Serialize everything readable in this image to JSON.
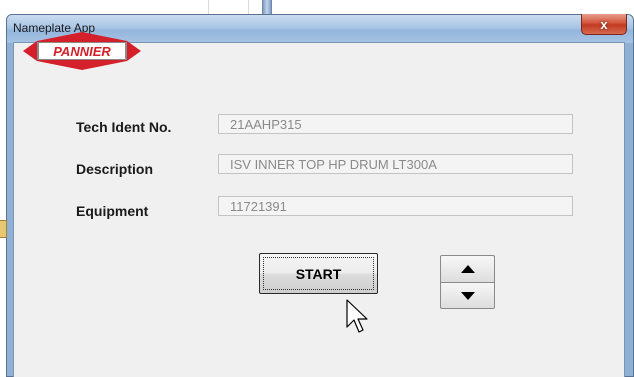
{
  "window": {
    "title": "Nameplate App",
    "close_label": "x"
  },
  "logo": {
    "text": "PANNIER",
    "colors": {
      "red": "#d4202a",
      "white": "#ffffff",
      "gray": "#8a8a8a"
    }
  },
  "form": {
    "fields": [
      {
        "label": "Tech Ident No.",
        "value": "21AAHP315"
      },
      {
        "label": "Description",
        "value": "ISV INNER TOP HP DRUM LT300A"
      },
      {
        "label": "Equipment",
        "value": "11721391"
      }
    ]
  },
  "actions": {
    "start_label": "START"
  },
  "spinner": {
    "up_icon": "triangle-up-icon",
    "down_icon": "triangle-down-icon"
  }
}
